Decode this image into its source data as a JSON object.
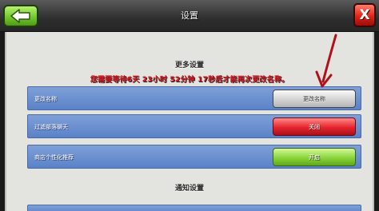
{
  "header": {
    "title": "设置",
    "back_icon": "back-arrow-icon",
    "close_label": "X"
  },
  "sections": {
    "more_settings": "更多设置",
    "notification_settings": "通知设置"
  },
  "notice": "您需要等待6天 23小时 52分钟 17秒后才能再次更改名称。",
  "rows": [
    {
      "label": "更改名称",
      "button": "更改名称",
      "style": "gray"
    },
    {
      "label": "过滤部落聊天",
      "button": "关闭",
      "style": "red"
    },
    {
      "label": "商店个性化推荐",
      "button": "开启",
      "style": "green"
    }
  ],
  "colors": {
    "notice": "#d8141c",
    "row_bg": "#6a8ed0",
    "panel_bg": "#e3e4e0"
  }
}
